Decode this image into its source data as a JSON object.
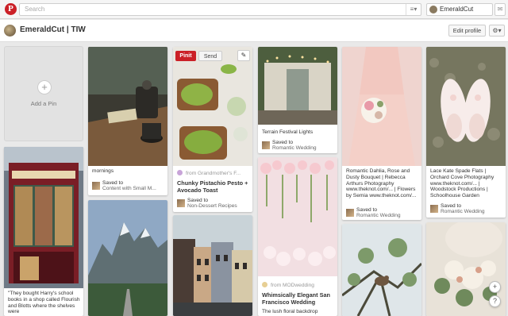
{
  "header": {
    "logo_glyph": "P",
    "search_placeholder": "Search",
    "menu_glyph": "≡▾",
    "user_name": "EmeraldCut",
    "messages_glyph": "✉"
  },
  "board": {
    "title": "EmeraldCut | TIW",
    "edit_label": "Edit profile",
    "settings_glyph": "⚙▾"
  },
  "add_pin": {
    "plus": "+",
    "label": "Add a Pin"
  },
  "pin_actions": {
    "pinit": "Pinit",
    "send": "Send",
    "edit_glyph": "✎"
  },
  "pins": [
    {
      "id": "books",
      "description": "\"They bought Harry's school books in a shop called Flourish and Blotts where the shelves were"
    },
    {
      "id": "mornings",
      "description": "mornings",
      "saved_to": "Saved to",
      "board": "Content with Small M..."
    },
    {
      "id": "mountains"
    },
    {
      "id": "avocado",
      "from": "from Grandmother's F...",
      "description": "Chunky Pistachio Pesto + Avocado Toast",
      "saved_to": "Saved to",
      "board": "Non-Dessert Recipes"
    },
    {
      "id": "houses"
    },
    {
      "id": "terrain",
      "description": "Terrain Festival Lights",
      "saved_to": "Saved to",
      "board": "Romantic Wedding"
    },
    {
      "id": "floral",
      "from": "from MODwedding",
      "description": "Whimsically Elegant San Francisco Wedding",
      "sub": "The lush floral backdrop"
    },
    {
      "id": "dahlia",
      "description": "Romantic Dahlia, Rose and Dusty Bouquet | Rebecca Arthurs Photography www.theknot.com/... | Flowers by Semia www.theknot.com/...",
      "saved_to": "Saved to",
      "board": "Romantic Wedding"
    },
    {
      "id": "bird"
    },
    {
      "id": "shoes",
      "description": "Lace Kate Spade Flats | Orchard Cove Photography www.theknot.com/... | Woodstock Productions | Schoolhouse Garden",
      "saved_to": "Saved to",
      "board": "Romantic Wedding"
    },
    {
      "id": "bouquet"
    }
  ],
  "floating": {
    "add": "+",
    "help": "?"
  }
}
